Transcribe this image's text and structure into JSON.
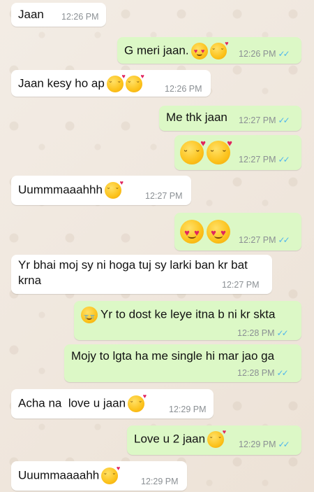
{
  "messages": [
    {
      "text": "Jaan",
      "time": "12:26 PM"
    },
    {
      "text": "G meri jaan.",
      "time": "12:26 PM",
      "emojis": [
        "heart-eyes-face",
        "kissing-face"
      ]
    },
    {
      "text": "Jaan kesy ho ap",
      "time": "12:26 PM",
      "emojis": [
        "kissing-face",
        "kissing-face"
      ]
    },
    {
      "text": "Me thk jaan",
      "time": "12:27 PM"
    },
    {
      "text": "",
      "time": "12:27 PM",
      "emojis": [
        "kissing-face",
        "kissing-face"
      ]
    },
    {
      "text": "Uummmaaahhh",
      "time": "12:27 PM",
      "emojis": [
        "kissing-face"
      ]
    },
    {
      "text": "",
      "time": "12:27 PM",
      "emojis": [
        "heart-eyes-face",
        "heart-eyes-face"
      ]
    },
    {
      "text": "Yr bhai moj sy ni hoga tuj sy larki ban kr bat krna",
      "time": "12:27 PM"
    },
    {
      "text": "Yr to dost ke leye itna b ni kr skta",
      "time": "12:28 PM",
      "emojis": [
        "crying-face"
      ]
    },
    {
      "text": "Mojy to lgta ha me single hi mar jao ga",
      "time": "12:28 PM"
    },
    {
      "text": "Acha na  love u jaan",
      "time": "12:29 PM",
      "emojis": [
        "kissing-face"
      ]
    },
    {
      "text": "Love u 2 jaan",
      "time": "12:29 PM",
      "emojis": [
        "kissing-face"
      ]
    },
    {
      "text": "Uuummaaaahh",
      "time": "12:29 PM",
      "emojis": [
        "kissing-face"
      ]
    }
  ],
  "colors": {
    "incoming": "#ffffff",
    "outgoing": "#dcf8c6",
    "read_tick": "#4fb6ec",
    "time": "#8b9094"
  },
  "icons": {
    "read_receipt": "double-check-icon"
  }
}
